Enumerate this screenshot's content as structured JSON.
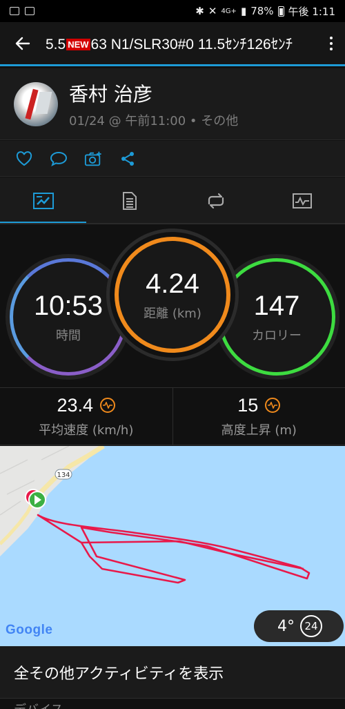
{
  "status_bar": {
    "battery": "78%",
    "time": "午後 1:11",
    "network": "4G+"
  },
  "app_bar": {
    "title_prefix": "5.5",
    "title_badge": "NEW",
    "title_suffix": "63 N1/SLR30#0 11.5ｾﾝﾁ126ｾﾝﾁ"
  },
  "header": {
    "user_name": "香村 治彦",
    "activity_meta": "01/24 @ 午前11:00 • その他"
  },
  "stats": {
    "time": {
      "value": "10:53",
      "label": "時間"
    },
    "distance": {
      "value": "4.24",
      "label": "距離 (km)"
    },
    "calories": {
      "value": "147",
      "label": "カロリー"
    }
  },
  "metrics": {
    "avg_speed": {
      "value": "23.4",
      "label": "平均速度 (km/h)"
    },
    "elev_gain": {
      "value": "15",
      "label": "高度上昇 (m)"
    }
  },
  "map": {
    "road_shield": "134",
    "attribution": "Google",
    "temperature": "4°",
    "wind_speed": "24"
  },
  "colors": {
    "accent": "#1d9bd7",
    "time_ring": "#7a6cd8",
    "distance_ring": "#f08a1c",
    "calories_ring": "#3ddc40",
    "route": "#e8194a"
  },
  "show_more": "全その他アクティビティを表示",
  "device_header": "デバイス"
}
